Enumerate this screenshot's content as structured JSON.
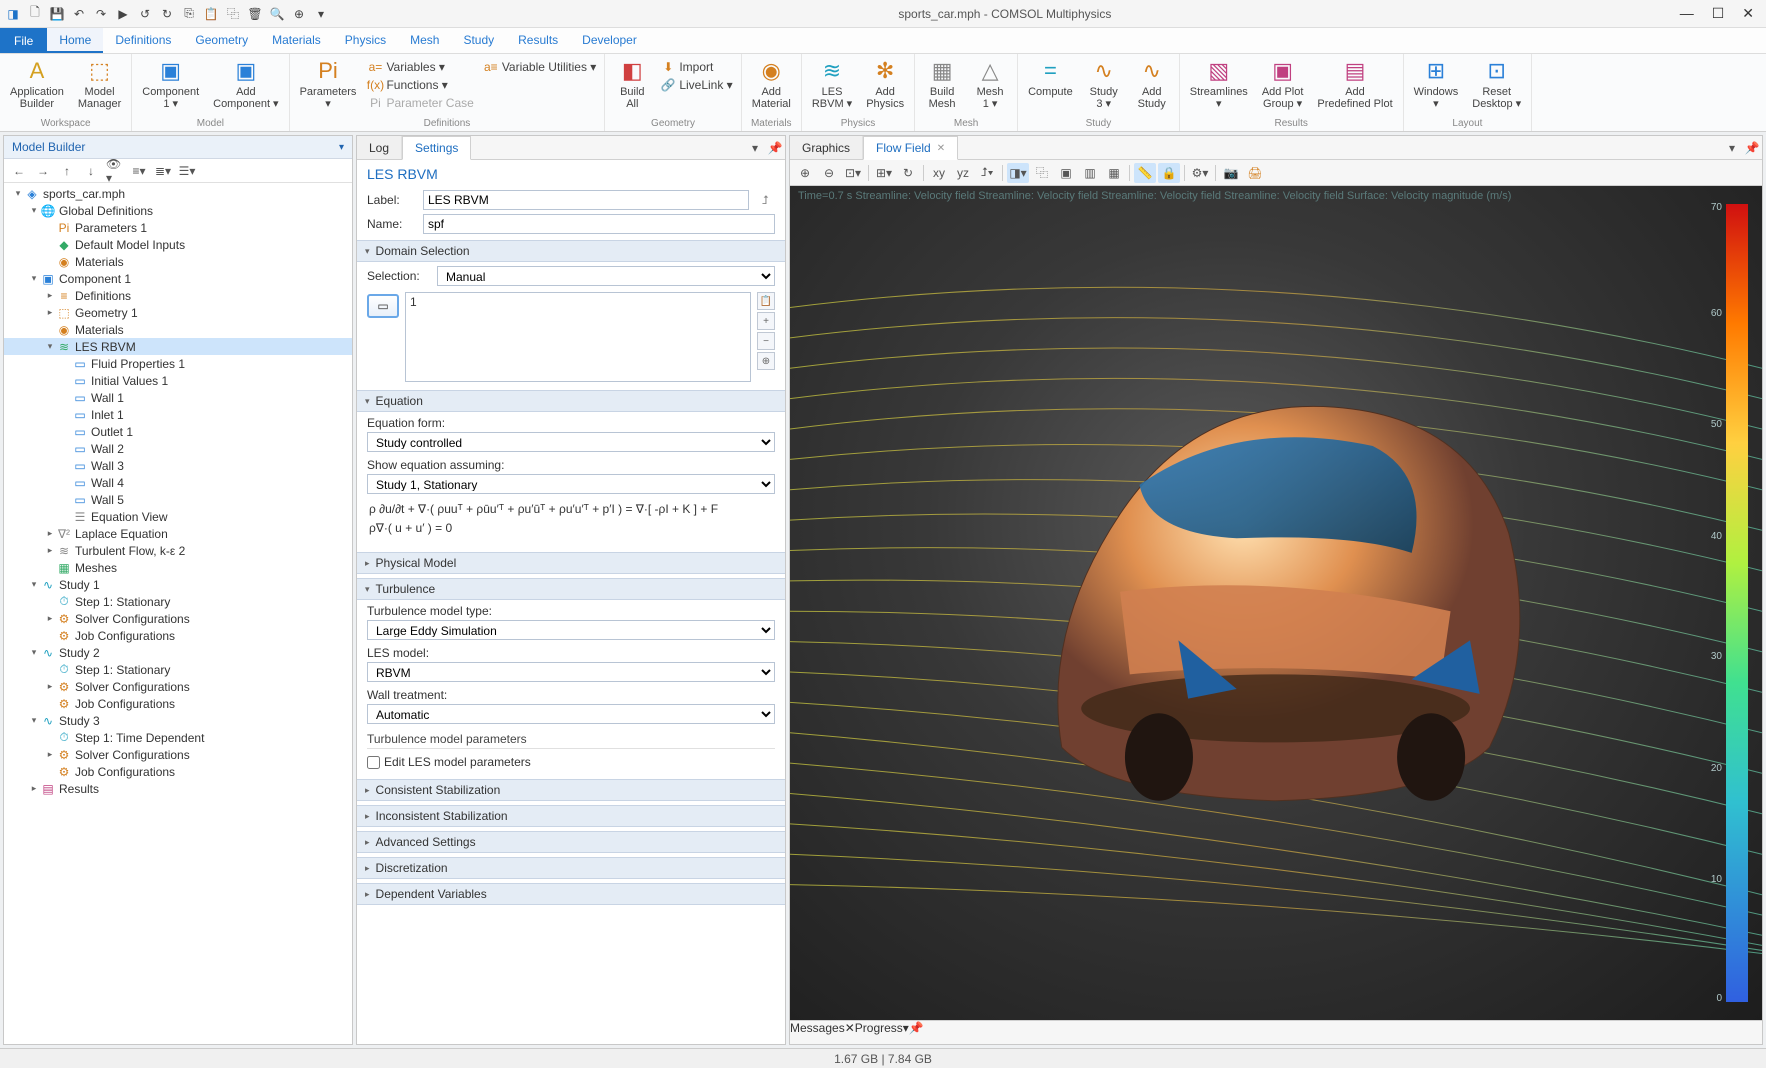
{
  "title": "sports_car.mph - COMSOL Multiphysics",
  "menu": {
    "file": "File",
    "tabs": [
      "Home",
      "Definitions",
      "Geometry",
      "Materials",
      "Physics",
      "Mesh",
      "Study",
      "Results",
      "Developer"
    ]
  },
  "ribbon": {
    "workspace": {
      "label": "Workspace",
      "app_builder": "Application\nBuilder",
      "model_manager": "Model\nManager"
    },
    "model": {
      "label": "Model",
      "component1": "Component\n1 ▾",
      "add_component": "Add\nComponent ▾"
    },
    "definitions": {
      "label": "Definitions",
      "parameters": "Parameters\n▾",
      "variables": "Variables ▾",
      "functions": "Functions ▾",
      "param_case": "Parameter Case",
      "var_util": "Variable Utilities ▾"
    },
    "geometry": {
      "label": "Geometry",
      "build_all": "Build\nAll",
      "import": "Import",
      "livelink": "LiveLink ▾"
    },
    "materials": {
      "label": "Materials",
      "add_material": "Add\nMaterial"
    },
    "physics": {
      "label": "Physics",
      "les": "LES\nRBVM ▾",
      "add_physics": "Add\nPhysics"
    },
    "mesh": {
      "label": "Mesh",
      "build_mesh": "Build\nMesh",
      "mesh1": "Mesh\n1 ▾"
    },
    "study": {
      "label": "Study",
      "compute": "Compute",
      "study3": "Study\n3 ▾",
      "add_study": "Add\nStudy"
    },
    "results": {
      "label": "Results",
      "streamlines": "Streamlines\n▾",
      "add_plot_group": "Add Plot\nGroup ▾",
      "add_predef": "Add\nPredefined Plot"
    },
    "layout": {
      "label": "Layout",
      "windows": "Windows\n▾",
      "reset": "Reset\nDesktop ▾"
    }
  },
  "model_builder": {
    "title": "Model Builder",
    "root": "sports_car.mph",
    "tree": [
      {
        "d": 1,
        "arr": "▾",
        "ic": "🌐",
        "c": "#d48020",
        "t": "Global Definitions"
      },
      {
        "d": 2,
        "arr": "",
        "ic": "Pi",
        "c": "#d48020",
        "t": "Parameters 1"
      },
      {
        "d": 2,
        "arr": "",
        "ic": "◆",
        "c": "#3a6",
        "t": "Default Model Inputs"
      },
      {
        "d": 2,
        "arr": "",
        "ic": "◉",
        "c": "#d48020",
        "t": "Materials"
      },
      {
        "d": 1,
        "arr": "▾",
        "ic": "▣",
        "c": "#2a80d8",
        "t": "Component 1"
      },
      {
        "d": 2,
        "arr": "▸",
        "ic": "≡",
        "c": "#d48020",
        "t": "Definitions"
      },
      {
        "d": 2,
        "arr": "▸",
        "ic": "⬚",
        "c": "#d48020",
        "t": "Geometry 1"
      },
      {
        "d": 2,
        "arr": "",
        "ic": "◉",
        "c": "#d48020",
        "t": "Materials"
      },
      {
        "d": 2,
        "arr": "▾",
        "ic": "≋",
        "c": "#3a6",
        "t": "LES RBVM",
        "sel": true
      },
      {
        "d": 3,
        "arr": "",
        "ic": "▭",
        "c": "#2a80d8",
        "t": "Fluid Properties 1"
      },
      {
        "d": 3,
        "arr": "",
        "ic": "▭",
        "c": "#2a80d8",
        "t": "Initial Values 1"
      },
      {
        "d": 3,
        "arr": "",
        "ic": "▭",
        "c": "#2a80d8",
        "t": "Wall 1"
      },
      {
        "d": 3,
        "arr": "",
        "ic": "▭",
        "c": "#2a80d8",
        "t": "Inlet 1"
      },
      {
        "d": 3,
        "arr": "",
        "ic": "▭",
        "c": "#2a80d8",
        "t": "Outlet 1"
      },
      {
        "d": 3,
        "arr": "",
        "ic": "▭",
        "c": "#2a80d8",
        "t": "Wall 2"
      },
      {
        "d": 3,
        "arr": "",
        "ic": "▭",
        "c": "#2a80d8",
        "t": "Wall 3"
      },
      {
        "d": 3,
        "arr": "",
        "ic": "▭",
        "c": "#2a80d8",
        "t": "Wall 4"
      },
      {
        "d": 3,
        "arr": "",
        "ic": "▭",
        "c": "#2a80d8",
        "t": "Wall 5"
      },
      {
        "d": 3,
        "arr": "",
        "ic": "☰",
        "c": "#888",
        "t": "Equation View"
      },
      {
        "d": 2,
        "arr": "▸",
        "ic": "∇²",
        "c": "#888",
        "t": "Laplace Equation"
      },
      {
        "d": 2,
        "arr": "▸",
        "ic": "≋",
        "c": "#888",
        "t": "Turbulent Flow, k-ε 2"
      },
      {
        "d": 2,
        "arr": "",
        "ic": "▦",
        "c": "#3a6",
        "t": "Meshes"
      },
      {
        "d": 1,
        "arr": "▾",
        "ic": "∿",
        "c": "#20a0c0",
        "t": "Study 1"
      },
      {
        "d": 2,
        "arr": "",
        "ic": "⏱",
        "c": "#20a0c0",
        "t": "Step 1: Stationary"
      },
      {
        "d": 2,
        "arr": "▸",
        "ic": "⚙",
        "c": "#d48020",
        "t": "Solver Configurations"
      },
      {
        "d": 2,
        "arr": "",
        "ic": "⚙",
        "c": "#d48020",
        "t": "Job Configurations"
      },
      {
        "d": 1,
        "arr": "▾",
        "ic": "∿",
        "c": "#20a0c0",
        "t": "Study 2"
      },
      {
        "d": 2,
        "arr": "",
        "ic": "⏱",
        "c": "#20a0c0",
        "t": "Step 1: Stationary"
      },
      {
        "d": 2,
        "arr": "▸",
        "ic": "⚙",
        "c": "#d48020",
        "t": "Solver Configurations"
      },
      {
        "d": 2,
        "arr": "",
        "ic": "⚙",
        "c": "#d48020",
        "t": "Job Configurations"
      },
      {
        "d": 1,
        "arr": "▾",
        "ic": "∿",
        "c": "#20a0c0",
        "t": "Study 3"
      },
      {
        "d": 2,
        "arr": "",
        "ic": "⏱",
        "c": "#20a0c0",
        "t": "Step 1: Time Dependent"
      },
      {
        "d": 2,
        "arr": "▸",
        "ic": "⚙",
        "c": "#d48020",
        "t": "Solver Configurations"
      },
      {
        "d": 2,
        "arr": "",
        "ic": "⚙",
        "c": "#d48020",
        "t": "Job Configurations"
      },
      {
        "d": 1,
        "arr": "▸",
        "ic": "▤",
        "c": "#c04080",
        "t": "Results"
      }
    ]
  },
  "settings": {
    "tabs": {
      "log": "Log",
      "settings": "Settings"
    },
    "header": "LES RBVM",
    "label_lbl": "Label:",
    "label_val": "LES RBVM",
    "name_lbl": "Name:",
    "name_val": "spf",
    "domain_sel": "Domain Selection",
    "selection_lbl": "Selection:",
    "selection_val": "Manual",
    "sel_list": "1",
    "equation": "Equation",
    "eq_form_lbl": "Equation form:",
    "eq_form_val": "Study controlled",
    "show_eq_lbl": "Show equation assuming:",
    "show_eq_val": "Study 1, Stationary",
    "eq_line1": "ρ ∂u/∂t + ∇·( ρuuᵀ + ρūu′ᵀ + ρu′ūᵀ + ρu′u′ᵀ + p′I ) = ∇·[ -ρI + K ] + F",
    "eq_line2": "ρ∇·( u + u′ ) = 0",
    "phys_model": "Physical Model",
    "turbulence": "Turbulence",
    "turb_type_lbl": "Turbulence model type:",
    "turb_type_val": "Large Eddy Simulation",
    "les_model_lbl": "LES model:",
    "les_model_val": "RBVM",
    "wall_lbl": "Wall treatment:",
    "wall_val": "Automatic",
    "turb_params": "Turbulence model parameters",
    "edit_les": "Edit LES model parameters",
    "cons_stab": "Consistent Stabilization",
    "incons_stab": "Inconsistent Stabilization",
    "adv_set": "Advanced Settings",
    "discret": "Discretization",
    "dep_vars": "Dependent Variables"
  },
  "graphics": {
    "tabs": {
      "graphics": "Graphics",
      "flow": "Flow Field"
    },
    "annot": "Time=0.7 s    Streamline: Velocity field   Streamline: Velocity field   Streamline: Velocity field   Streamline: Velocity field   Surface: Velocity magnitude (m/s)",
    "legend": {
      "max": "70",
      "t60": "60",
      "t50": "50",
      "t40": "40",
      "t30": "30",
      "t20": "20",
      "t10": "10",
      "min": "0"
    },
    "bottom": {
      "messages": "Messages",
      "progress": "Progress"
    }
  },
  "status": "1.67 GB | 7.84 GB"
}
